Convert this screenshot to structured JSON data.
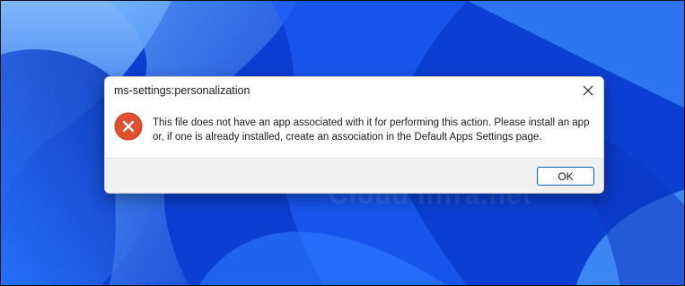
{
  "desktop": {
    "wallpaper": "windows-11-bloom-wallpaper",
    "accent_color": "#0a4be6"
  },
  "dialog": {
    "title": "ms-settings:personalization",
    "close_icon": "close-icon",
    "error_icon": "error-x-icon",
    "error_color": "#e0502c",
    "message": "This file does not have an app associated with it for performing this action. Please install an app or, if one is already installed, create an association in the Default Apps Settings page.",
    "ok_label": "OK",
    "ok_border_color": "#0067c0"
  }
}
